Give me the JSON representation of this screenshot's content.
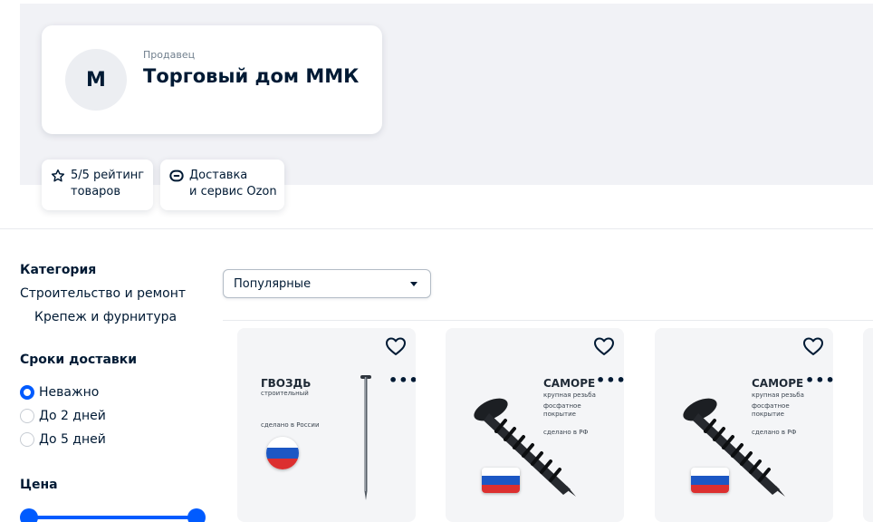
{
  "seller": {
    "label": "Продавец",
    "name": "Торговый дом ММК",
    "avatar_letter": "M"
  },
  "badges": {
    "rating": {
      "line1": "5/5 рейтинг",
      "line2": "товаров",
      "icon": "star-icon"
    },
    "delivery": {
      "line1": "Доставка",
      "line2": "и сервис Ozon",
      "icon": "ozon-logo-icon"
    }
  },
  "filters": {
    "category": {
      "title": "Категория",
      "items": [
        "Строительство и ремонт",
        "Крепеж и фурнитура"
      ]
    },
    "delivery_time": {
      "title": "Сроки доставки",
      "options": [
        {
          "label": "Неважно",
          "checked": true
        },
        {
          "label": "До 2 дней",
          "checked": false
        },
        {
          "label": "До 5 дней",
          "checked": false
        }
      ]
    },
    "price": {
      "title": "Цена"
    }
  },
  "sort": {
    "value": "Популярные"
  },
  "products": [
    {
      "title": "ГВОЗДЬ",
      "subtitle_lines": [
        "строительный"
      ],
      "made_in": "сделано в России",
      "graphic": "nail-icon"
    },
    {
      "title": "САМОРЕ",
      "subtitle_lines": [
        "крупная резьба",
        "",
        "фосфатное",
        "покрытие"
      ],
      "made_in": "сделано в РФ",
      "graphic": "screw-icon"
    },
    {
      "title": "САМОРЕ",
      "subtitle_lines": [
        "крупная резьба",
        "",
        "фосфатное",
        "покрытие"
      ],
      "made_in": "сделано в РФ",
      "graphic": "screw-icon"
    }
  ],
  "colors": {
    "accent": "#005bff",
    "text": "#001a34",
    "hero_background": "#f1f2f6"
  }
}
